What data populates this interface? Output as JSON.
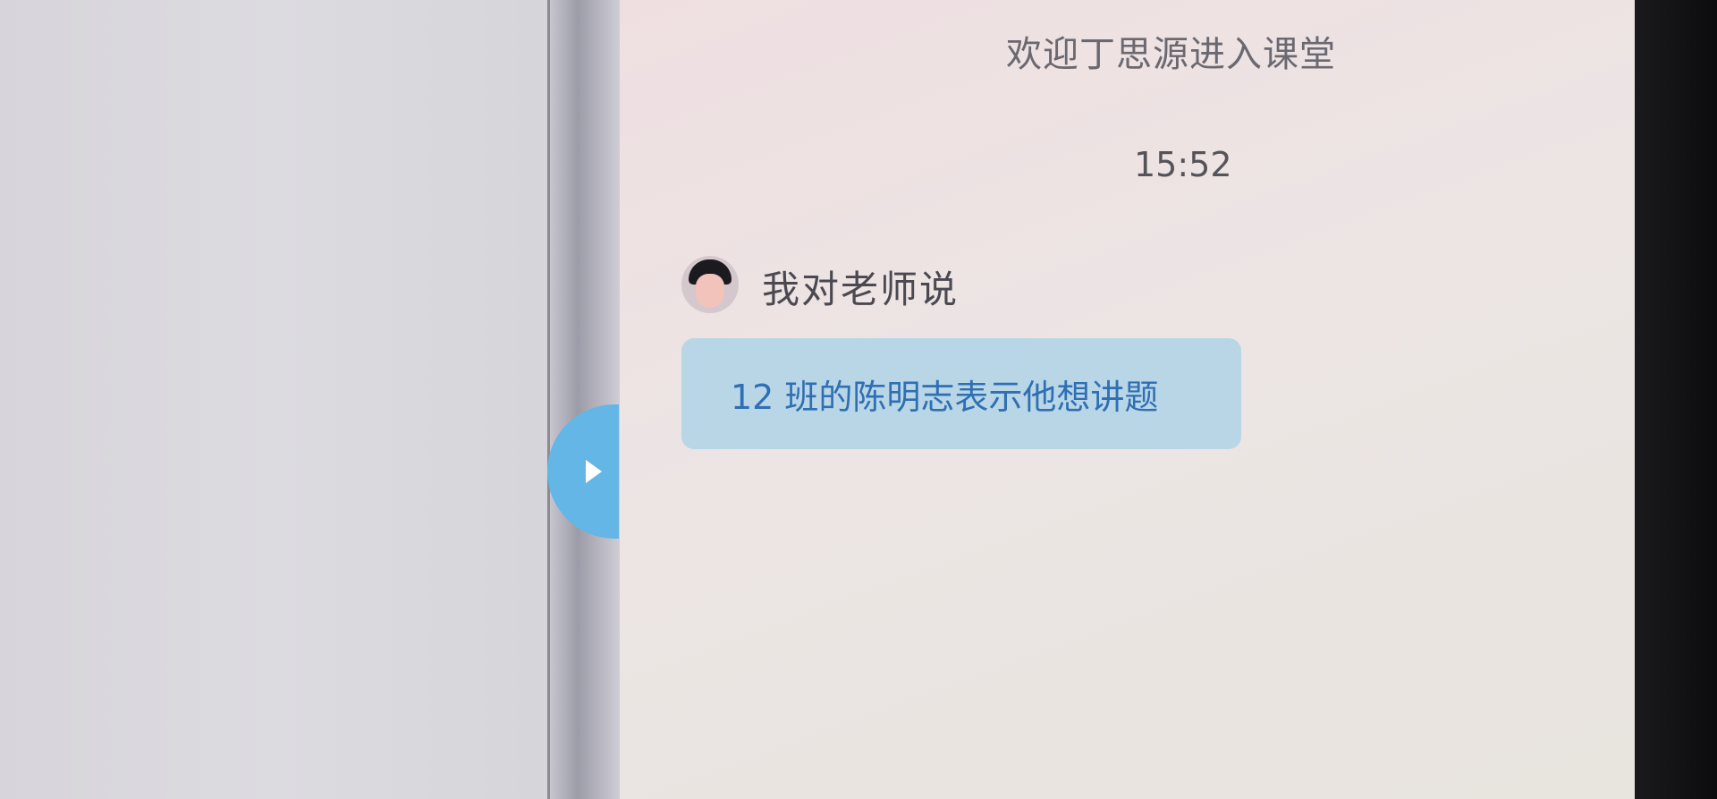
{
  "chat": {
    "system_message": "欢迎丁思源进入课堂",
    "timestamp": "15:52",
    "sender_label": "我对老师说",
    "message_text": "12 班的陈明志表示他想讲题"
  },
  "icons": {
    "collapse_toggle": "play-icon",
    "avatar": "user-avatar-icon"
  },
  "colors": {
    "toggle_accent": "#63b6e6",
    "bubble_background": "#b9d6e6",
    "message_text": "#2f6fb3"
  }
}
